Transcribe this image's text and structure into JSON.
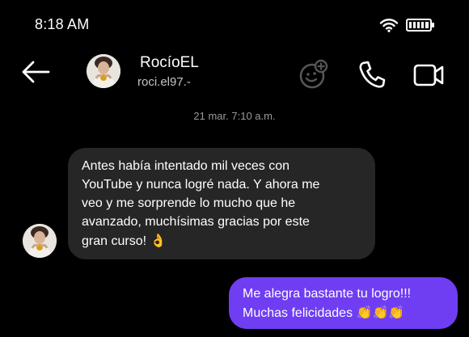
{
  "status_bar": {
    "time": "8:18 AM",
    "icons": [
      "wifi-icon",
      "battery-icon"
    ]
  },
  "header": {
    "contact_name": "RocíoEL",
    "username": "roci.el97.-",
    "icons": [
      "back-arrow-icon",
      "emoji-add-icon",
      "phone-icon",
      "video-camera-icon"
    ]
  },
  "chat": {
    "timestamp": "21 mar. 7:10 a.m.",
    "messages": [
      {
        "direction": "incoming",
        "lines": [
          "Antes había intentado mil veces con",
          "YouTube y nunca logré nada. Y ahora me",
          "veo y me sorprende lo mucho que he",
          "avanzado, muchísimas gracias por este",
          "gran curso!"
        ],
        "emoji": "👌"
      },
      {
        "direction": "outgoing",
        "lines": [
          "Me alegra bastante tu logro!!!",
          "Muchas felicidades"
        ],
        "emoji": "👏👏👏"
      }
    ]
  },
  "colors": {
    "background": "#000000",
    "incoming_bubble": "#262626",
    "outgoing_bubble": "#6f3df2",
    "secondary_text": "#c4c4c4",
    "timestamp_text": "#9a9a9a"
  }
}
